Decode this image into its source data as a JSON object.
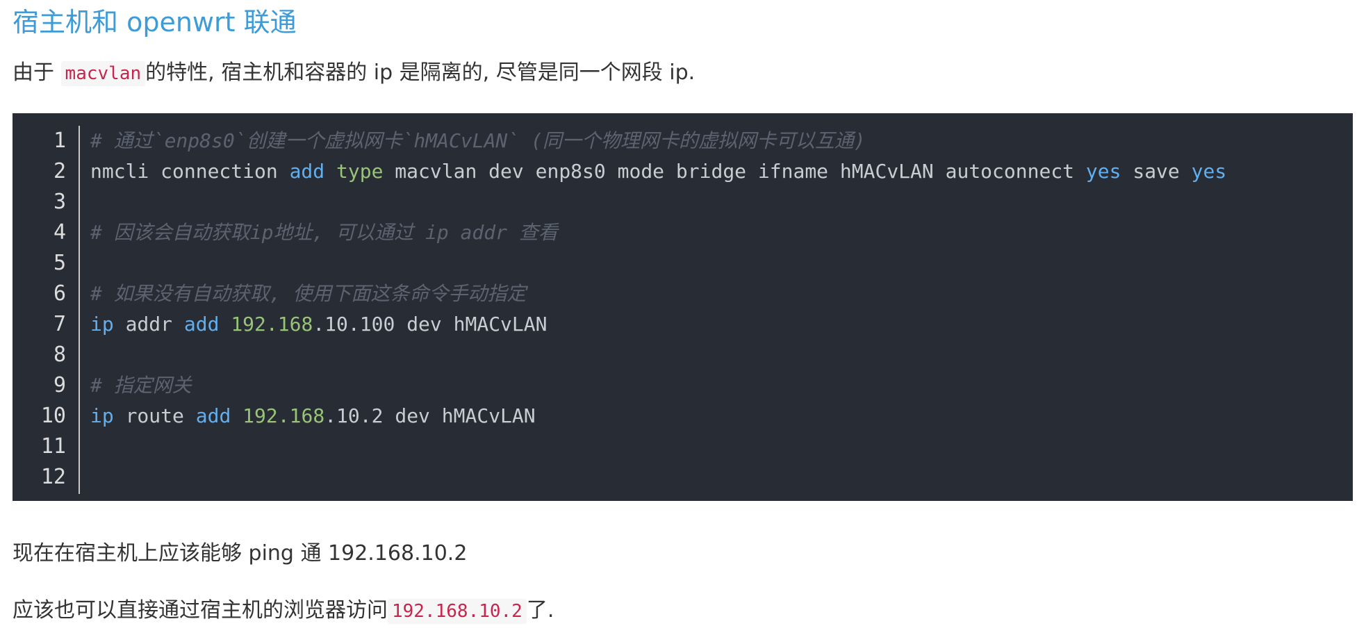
{
  "heading": "宿主机和 openwrt 联通",
  "intro": {
    "before": "由于 ",
    "code": "macvlan",
    "after": "的特性, 宿主机和容器的 ip 是隔离的, 尽管是同一个网段 ip."
  },
  "code_block": {
    "line_numbers": [
      "1",
      "2",
      "3",
      "4",
      "5",
      "6",
      "7",
      "8",
      "9",
      "10",
      "11",
      "12"
    ],
    "lines": {
      "l1_comment": "# 通过`enp8s0`创建一个虚拟网卡`hMACvLAN` (同一个物理网卡的虚拟网卡可以互通)",
      "l2_cmd": "nmcli connection ",
      "l2_add": "add",
      "l2_type": "type",
      "l2_rest": " macvlan dev enp8s0 mode bridge ifname hMACvLAN autoconnect ",
      "l2_yes1": "yes",
      "l2_save": " save ",
      "l2_yes2": "yes",
      "l4_comment": "# 因该会自动获取ip地址, 可以通过 ip addr 查看",
      "l6_comment": "# 如果没有自动获取, 使用下面这条命令手动指定",
      "l7_ip": "ip",
      "l7_addr": " addr ",
      "l7_add": "add",
      "l7_num": "192.168",
      "l7_rest": ".10.100 dev hMACvLAN",
      "l9_comment": "# 指定网关",
      "l10_ip": "ip",
      "l10_route": " route ",
      "l10_add": "add",
      "l10_num": "192.168",
      "l10_rest": ".10.2 dev hMACvLAN"
    }
  },
  "para2": "现在在宿主机上应该能够 ping 通 192.168.10.2",
  "para3": {
    "before": "应该也可以直接通过宿主机的浏览器访问",
    "code": "192.168.10.2",
    "after": "了."
  },
  "colors": {
    "heading": "#3d9bd8",
    "code_bg": "#282c34",
    "comment": "#5c6370",
    "keyword": "#61afef",
    "type": "#98c379",
    "inline_code": "#c7254e"
  }
}
